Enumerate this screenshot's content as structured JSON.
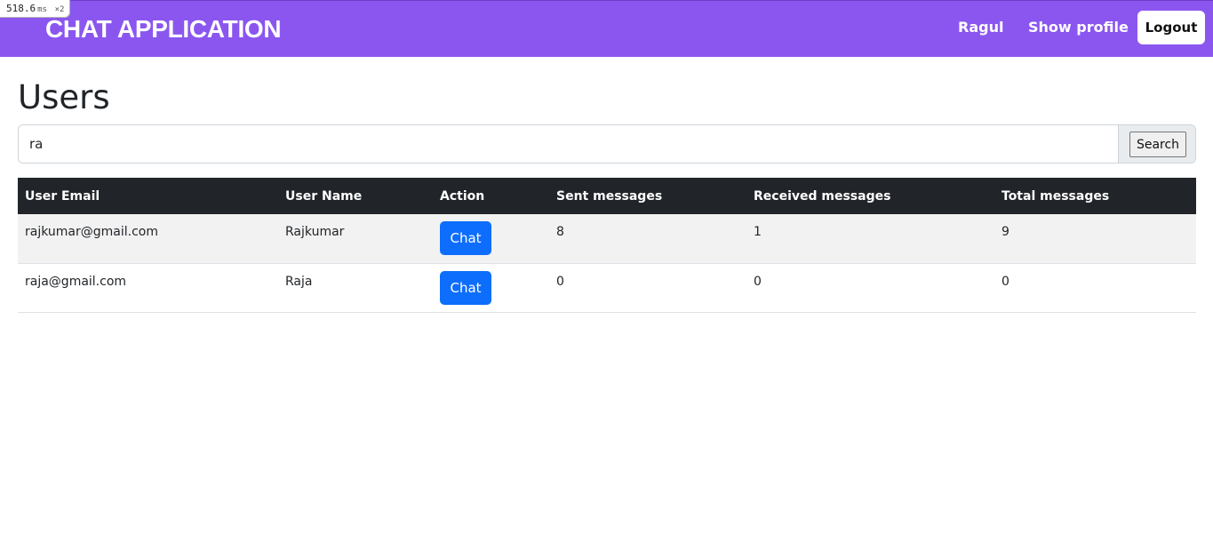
{
  "perf": {
    "value": "518.6",
    "unit": "ms",
    "multiplier": "×2"
  },
  "navbar": {
    "brand": "CHAT APPLICATION",
    "user_name": "Ragul",
    "show_profile": "Show profile",
    "logout": "Logout",
    "bg_color": "#8b56ef"
  },
  "page": {
    "title": "Users"
  },
  "search": {
    "value": "ra",
    "placeholder": "",
    "button": "Search"
  },
  "table": {
    "headers": [
      "User Email",
      "User Name",
      "Action",
      "Sent messages",
      "Received messages",
      "Total messages"
    ],
    "rows": [
      {
        "email": "rajkumar@gmail.com",
        "name": "Rajkumar",
        "action": "Chat",
        "sent": "8",
        "received": "1",
        "total": "9"
      },
      {
        "email": "raja@gmail.com",
        "name": "Raja",
        "action": "Chat",
        "sent": "0",
        "received": "0",
        "total": "0"
      }
    ]
  },
  "colors": {
    "primary_button": "#0d6efd",
    "table_header": "#212529"
  }
}
